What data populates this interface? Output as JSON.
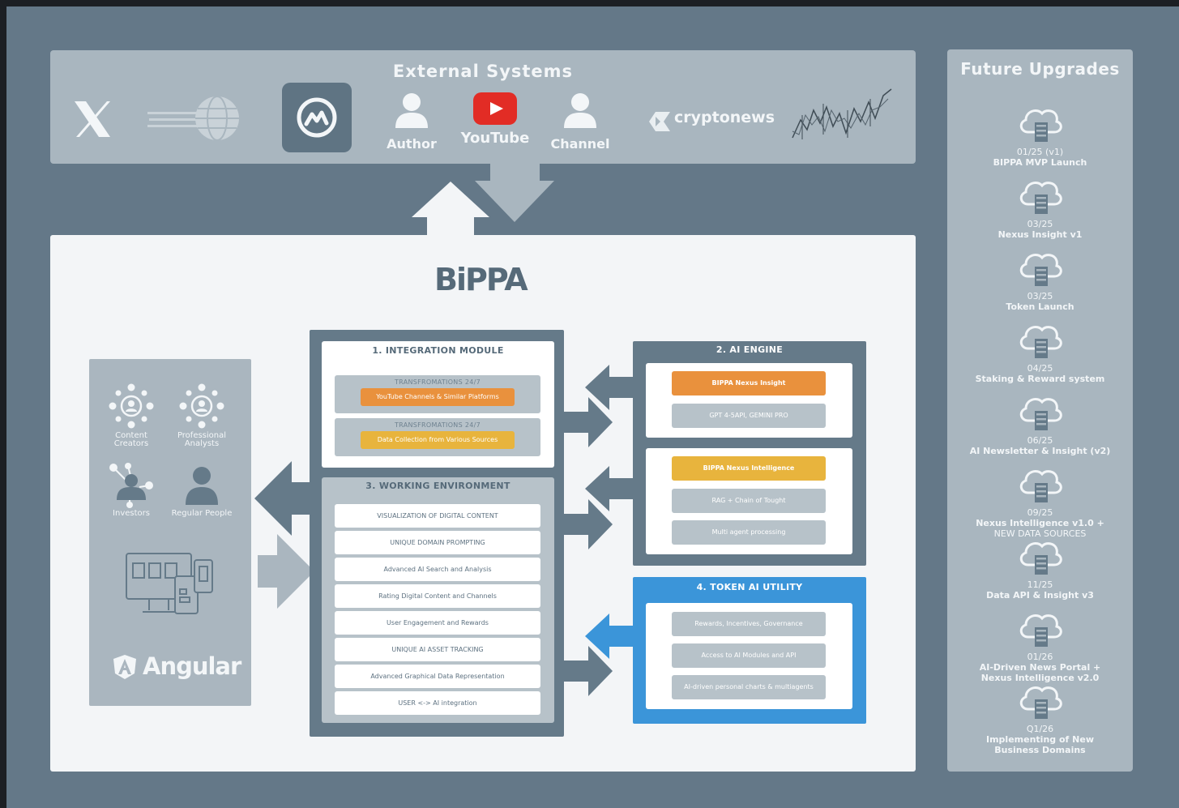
{
  "external": {
    "title": "External Systems",
    "items": [
      {
        "icon": "x-logo-icon"
      },
      {
        "icon": "globe-icon"
      },
      {
        "icon": "coinmarketcap-icon"
      },
      {
        "icon": "person-icon",
        "label": "Author"
      },
      {
        "icon": "youtube-icon",
        "label": "YouTube"
      },
      {
        "icon": "person-icon",
        "label": "Channel"
      },
      {
        "icon": "cryptonews-icon",
        "label": "cryptonews"
      },
      {
        "icon": "stock-chart-icon"
      }
    ]
  },
  "main": {
    "logo": "BiPPA",
    "users": [
      {
        "label": "Content Creators",
        "icon": "network-person-icon"
      },
      {
        "label": "Professional Analysts",
        "icon": "network-person-icon"
      },
      {
        "label": "Investors",
        "icon": "investor-icon"
      },
      {
        "label": "Regular People",
        "icon": "person-icon"
      }
    ],
    "framework": "Angular",
    "integration": {
      "title": "1. INTEGRATION MODULE",
      "blocks": [
        {
          "caption": "TRANSFROMATIONS 24/7",
          "pill": "YouTube Channels & Similar Platforms"
        },
        {
          "caption": "TRANSFROMATIONS 24/7",
          "pill": "Data Collection from Various Sources"
        }
      ]
    },
    "working": {
      "title": "3. WORKING ENVIRONMENT",
      "rows": [
        "VISUALIZATION OF DIGITAL CONTENT",
        "UNIQUE DOMAIN PROMPTING",
        "Advanced AI Search and Analysis",
        "Rating Digital Content and Channels",
        "User Engagement and Rewards",
        "UNIQUE AI ASSET TRACKING",
        "Advanced Graphical Data Representation",
        "USER <-> AI integration"
      ]
    },
    "ai_engine": {
      "title": "2. AI ENGINE",
      "insight": {
        "title": "BIPPA Nexus Insight",
        "items": [
          "GPT 4-5API, GEMINI PRO"
        ]
      },
      "intelligence": {
        "title": "BIPPA Nexus Intelligence",
        "items": [
          "RAG + Chain of Tought",
          "Multi agent processing"
        ]
      }
    },
    "token": {
      "title": "4. TOKEN AI UTILITY",
      "items": [
        "Rewards, Incentives, Governance",
        "Access to AI Modules and API",
        "AI-driven personal charts & multiagents"
      ]
    }
  },
  "future": {
    "title": "Future Upgrades",
    "items": [
      {
        "date": "01/25 (v1)",
        "desc": "BIPPA MVP Launch",
        "desc2": ""
      },
      {
        "date": "03/25",
        "desc": "Nexus Insight v1",
        "desc2": ""
      },
      {
        "date": "03/25",
        "desc": "Token Launch",
        "desc2": ""
      },
      {
        "date": "04/25",
        "desc": "Staking & Reward system",
        "desc2": ""
      },
      {
        "date": "06/25",
        "desc": "AI Newsletter & Insight (v2)",
        "desc2": ""
      },
      {
        "date": "09/25",
        "desc": "Nexus Intelligence v1.0 +",
        "desc2": "NEW DATA SOURCES"
      },
      {
        "date": "11/25",
        "desc": "Data API & Insight v3",
        "desc2": ""
      },
      {
        "date": "01/26",
        "desc": "AI-Driven News Portal +",
        "desc2": "Nexus Intelligence v2.0"
      },
      {
        "date": "Q1/26",
        "desc": "Implementing of New",
        "desc2": "Business Domains"
      }
    ]
  },
  "colors": {
    "background": "#647888",
    "panel": "#a9b6bf",
    "dark_module": "#657a89",
    "token_blue": "#3b95d9",
    "orange": "#e9913d",
    "yellow": "#e8b43d"
  }
}
